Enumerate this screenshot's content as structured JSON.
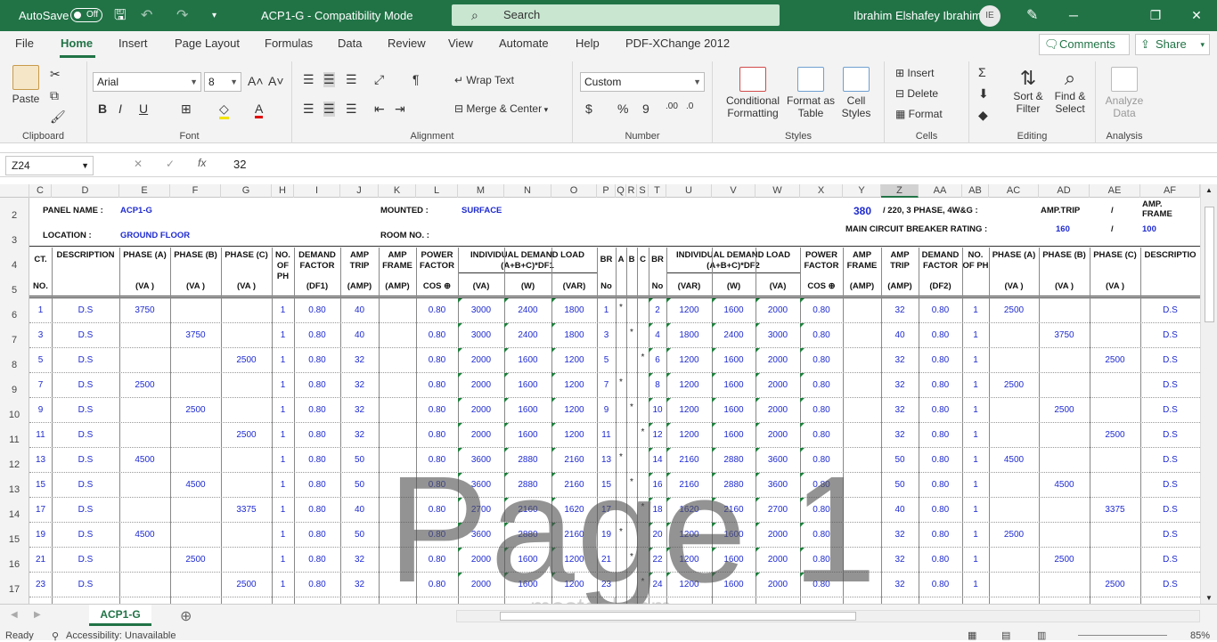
{
  "titlebar": {
    "autosave": "AutoSave",
    "toggle": "Off",
    "doc_title": "ACP1-G  -  Compatibility Mode",
    "search": "Search",
    "user": "Ibrahim Elshafey Ibrahim",
    "initials": "IE"
  },
  "tabs": [
    "File",
    "Home",
    "Insert",
    "Page Layout",
    "Formulas",
    "Data",
    "Review",
    "View",
    "Automate",
    "Help",
    "PDF-XChange 2012"
  ],
  "comments": "Comments",
  "share": "Share",
  "ribbon": {
    "paste": "Paste",
    "clipboard": "Clipboard",
    "font_name": "Arial",
    "font_size": "8",
    "font": "Font",
    "alignment": "Alignment",
    "wrap": "Wrap Text",
    "merge": "Merge & Center",
    "number_format": "Custom",
    "number": "Number",
    "cond": "Conditional Formatting",
    "fmt_table": "Format as Table",
    "cell_styles": "Cell Styles",
    "styles": "Styles",
    "insert": "Insert",
    "delete": "Delete",
    "format": "Format",
    "cells": "Cells",
    "sort": "Sort & Filter",
    "find": "Find & Select",
    "editing": "Editing",
    "analyze": "Analyze Data",
    "analysis": "Analysis"
  },
  "formula": {
    "cell": "Z24",
    "value": "32",
    "fx": "fx"
  },
  "columns": [
    "C",
    "D",
    "E",
    "F",
    "G",
    "H",
    "I",
    "J",
    "K",
    "L",
    "M",
    "N",
    "O",
    "P",
    "Q",
    "R",
    "S",
    "T",
    "U",
    "V",
    "W",
    "X",
    "Y",
    "Z",
    "AA",
    "AB",
    "AC",
    "AD",
    "AE",
    "AF"
  ],
  "rows": [
    "2",
    "3",
    "4",
    "5",
    "6",
    "7",
    "8",
    "9",
    "10",
    "11",
    "12",
    "13",
    "14",
    "15",
    "16",
    "17"
  ],
  "header": {
    "panel_name": "PANEL NAME  :",
    "panel_val": "ACP1-G",
    "mounted": "MOUNTED   :",
    "mounted_val": "SURFACE",
    "voltage": "380",
    "voltage_text": "/ 220, 3 PHASE, 4W&G :",
    "amp_trip": "AMP.TRIP",
    "slash": "/",
    "amp_frame": "AMP. FRAME",
    "location": "LOCATION    :",
    "location_val": "GROUND FLOOR",
    "room": "ROOM NO.  :",
    "mcb": "MAIN CIRCUIT BREAKER RATING :",
    "mcb_trip": "160",
    "mcb_frame": "100"
  },
  "colhead_top": [
    "CT.",
    "DESCRIPTION",
    "PHASE (A)",
    "PHASE (B)",
    "PHASE (C)",
    "NO. OF PH",
    "DEMAND FACTOR",
    "AMP TRIP",
    "AMP FRAME",
    "POWER FACTOR",
    "INDIVIDUAL DEMAND LOAD (A+B+C)*DF1",
    "BR",
    "A",
    "B",
    "C",
    "BR",
    "INDIVIDUAL DEMAND LOAD (A+B+C)*DF2",
    "POWER FACTOR",
    "AMP FRAME",
    "AMP TRIP",
    "DEMAND FACTOR",
    "NO. OF PH",
    "PHASE (A)",
    "PHASE (B)",
    "PHASE (C)",
    "DESCRIPTIO"
  ],
  "colhead_bottom": [
    "NO.",
    "(VA )",
    "(VA )",
    "(VA )",
    "(DF1)",
    "(AMP)",
    "(AMP)",
    "COS ⊕",
    "(VA)",
    "(W)",
    "(VAR)",
    "No",
    "No",
    "(VAR)",
    "(W)",
    "(VA)",
    "COS ⊕",
    "(AMP)",
    "(AMP)",
    "(DF2)",
    "(VA )",
    "(VA )",
    "(VA )"
  ],
  "circuits": [
    [
      "1",
      "D.S",
      "3750",
      "",
      "",
      "1",
      "0.80",
      "40",
      "",
      "0.80",
      "3000",
      "2400",
      "1800",
      "1",
      "*",
      "",
      "",
      "2",
      "1200",
      "1600",
      "2000",
      "0.80",
      "",
      "32",
      "0.80",
      "1",
      "2500",
      "",
      "",
      "D.S"
    ],
    [
      "3",
      "D.S",
      "",
      "3750",
      "",
      "1",
      "0.80",
      "40",
      "",
      "0.80",
      "3000",
      "2400",
      "1800",
      "3",
      "",
      "*",
      "",
      "4",
      "1800",
      "2400",
      "3000",
      "0.80",
      "",
      "40",
      "0.80",
      "1",
      "",
      "3750",
      "",
      "D.S"
    ],
    [
      "5",
      "D.S",
      "",
      "",
      "2500",
      "1",
      "0.80",
      "32",
      "",
      "0.80",
      "2000",
      "1600",
      "1200",
      "5",
      "",
      "",
      "*",
      "6",
      "1200",
      "1600",
      "2000",
      "0.80",
      "",
      "32",
      "0.80",
      "1",
      "",
      "",
      "2500",
      "D.S"
    ],
    [
      "7",
      "D.S",
      "2500",
      "",
      "",
      "1",
      "0.80",
      "32",
      "",
      "0.80",
      "2000",
      "1600",
      "1200",
      "7",
      "*",
      "",
      "",
      "8",
      "1200",
      "1600",
      "2000",
      "0.80",
      "",
      "32",
      "0.80",
      "1",
      "2500",
      "",
      "",
      "D.S"
    ],
    [
      "9",
      "D.S",
      "",
      "2500",
      "",
      "1",
      "0.80",
      "32",
      "",
      "0.80",
      "2000",
      "1600",
      "1200",
      "9",
      "",
      "*",
      "",
      "10",
      "1200",
      "1600",
      "2000",
      "0.80",
      "",
      "32",
      "0.80",
      "1",
      "",
      "2500",
      "",
      "D.S"
    ],
    [
      "11",
      "D.S",
      "",
      "",
      "2500",
      "1",
      "0.80",
      "32",
      "",
      "0.80",
      "2000",
      "1600",
      "1200",
      "11",
      "",
      "",
      "*",
      "12",
      "1200",
      "1600",
      "2000",
      "0.80",
      "",
      "32",
      "0.80",
      "1",
      "",
      "",
      "2500",
      "D.S"
    ],
    [
      "13",
      "D.S",
      "4500",
      "",
      "",
      "1",
      "0.80",
      "50",
      "",
      "0.80",
      "3600",
      "2880",
      "2160",
      "13",
      "*",
      "",
      "",
      "14",
      "2160",
      "2880",
      "3600",
      "0.80",
      "",
      "50",
      "0.80",
      "1",
      "4500",
      "",
      "",
      "D.S"
    ],
    [
      "15",
      "D.S",
      "",
      "4500",
      "",
      "1",
      "0.80",
      "50",
      "",
      "0.80",
      "3600",
      "2880",
      "2160",
      "15",
      "",
      "*",
      "",
      "16",
      "2160",
      "2880",
      "3600",
      "0.80",
      "",
      "50",
      "0.80",
      "1",
      "",
      "4500",
      "",
      "D.S"
    ],
    [
      "17",
      "D.S",
      "",
      "",
      "3375",
      "1",
      "0.80",
      "40",
      "",
      "0.80",
      "2700",
      "2160",
      "1620",
      "17",
      "",
      "",
      "*",
      "18",
      "1620",
      "2160",
      "2700",
      "0.80",
      "",
      "40",
      "0.80",
      "1",
      "",
      "",
      "3375",
      "D.S"
    ],
    [
      "19",
      "D.S",
      "4500",
      "",
      "",
      "1",
      "0.80",
      "50",
      "",
      "0.80",
      "3600",
      "2880",
      "2160",
      "19",
      "*",
      "",
      "",
      "20",
      "1200",
      "1600",
      "2000",
      "0.80",
      "",
      "32",
      "0.80",
      "1",
      "2500",
      "",
      "",
      "D.S"
    ],
    [
      "21",
      "D.S",
      "",
      "2500",
      "",
      "1",
      "0.80",
      "32",
      "",
      "0.80",
      "2000",
      "1600",
      "1200",
      "21",
      "",
      "*",
      "",
      "22",
      "1200",
      "1600",
      "2000",
      "0.80",
      "",
      "32",
      "0.80",
      "1",
      "",
      "2500",
      "",
      "D.S"
    ],
    [
      "23",
      "D.S",
      "",
      "",
      "2500",
      "1",
      "0.80",
      "32",
      "",
      "0.80",
      "2000",
      "1600",
      "1200",
      "23",
      "",
      "",
      "*",
      "24",
      "1200",
      "1600",
      "2000",
      "0.80",
      "",
      "32",
      "0.80",
      "1",
      "",
      "",
      "2500",
      "D.S"
    ]
  ],
  "watermark": "Page 1",
  "watermark2": "mostaql.com",
  "sheet": "ACP1-G",
  "status": {
    "ready": "Ready",
    "accessibility": "Accessibility: Unavailable",
    "zoom": "85%"
  }
}
